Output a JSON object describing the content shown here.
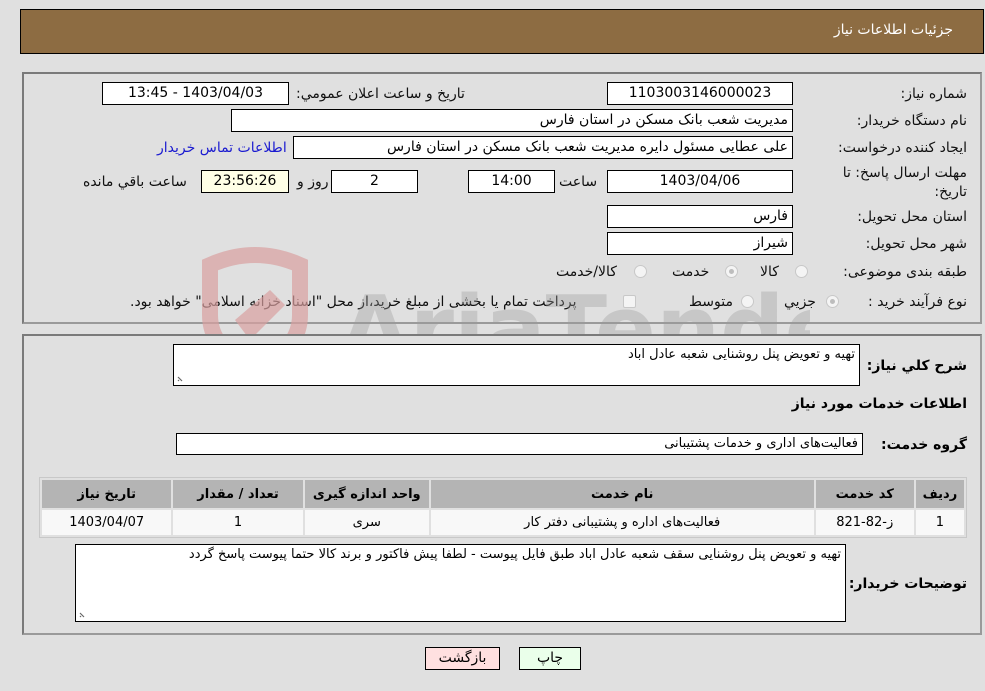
{
  "header": {
    "title": "جزئیات اطلاعات نیاز"
  },
  "fields": {
    "need_number": {
      "label": "شماره نیاز:",
      "value": "1103003146000023"
    },
    "announce_datetime": {
      "label": "تاریخ و ساعت اعلان عمومي:",
      "value": "1403/04/03 - 13:45"
    },
    "buyer_org": {
      "label": "نام دستگاه خریدار:",
      "value": "مدیریت شعب بانک مسکن در استان فارس"
    },
    "requester": {
      "label": "ایجاد کننده درخواست:",
      "value": "علی عطایی مسئول دایره مدیریت شعب بانک مسکن در استان فارس"
    },
    "buyer_contact_link": "اطلاعات تماس خریدار",
    "deadline": {
      "label": "مهلت ارسال پاسخ: تا تاریخ:",
      "date": "1403/04/06",
      "time_label": "ساعت",
      "time": "14:00",
      "days": "2",
      "days_label": "روز و",
      "remaining": "23:56:26",
      "remaining_label": "ساعت باقي مانده"
    },
    "delivery_province": {
      "label": "استان محل تحویل:",
      "value": "فارس"
    },
    "delivery_city": {
      "label": "شهر محل تحویل:",
      "value": "شیراز"
    },
    "category": {
      "label": "طبقه بندی موضوعی:",
      "options": [
        "کالا",
        "خدمت",
        "کالا/خدمت"
      ],
      "selected": "خدمت"
    },
    "purchase_type": {
      "label": "نوع فرآیند خرید :",
      "options": [
        "جزيي",
        "متوسط"
      ],
      "selected": "جزيي",
      "treasury_note": "پرداخت تمام یا بخشی از مبلغ خرید،از محل \"اسناد خزانه اسلامی\" خواهد بود."
    }
  },
  "description": {
    "label": "شرح کلي نیاز:",
    "value": "تهیه و تعویض پنل روشنایی شعبه عادل اباد"
  },
  "services": {
    "section_title": "اطلاعات خدمات مورد نیاز",
    "group_label": "گروه خدمت:",
    "group_value": "فعالیت‌های اداری و خدمات پشتیبانی",
    "table": {
      "headers": [
        "ردیف",
        "کد خدمت",
        "نام خدمت",
        "واحد اندازه گیری",
        "تعداد / مقدار",
        "تاریخ نیاز"
      ],
      "rows": [
        [
          "1",
          "ز-82-821",
          "فعالیت‌های اداره و پشتیبانی دفتر کار",
          "سری",
          "1",
          "1403/04/07"
        ]
      ]
    }
  },
  "buyer_notes": {
    "label": "توضیحات خریدار:",
    "value": "تهیه و تعویض پنل روشنایی سقف شعبه عادل اباد طبق فایل پیوست - لطفا پیش فاکتور و برند کالا حتما پیوست پاسخ گردد"
  },
  "buttons": {
    "print": "چاپ",
    "back": "بازگشت"
  },
  "watermark": {
    "text": "AriaTender.neT"
  }
}
